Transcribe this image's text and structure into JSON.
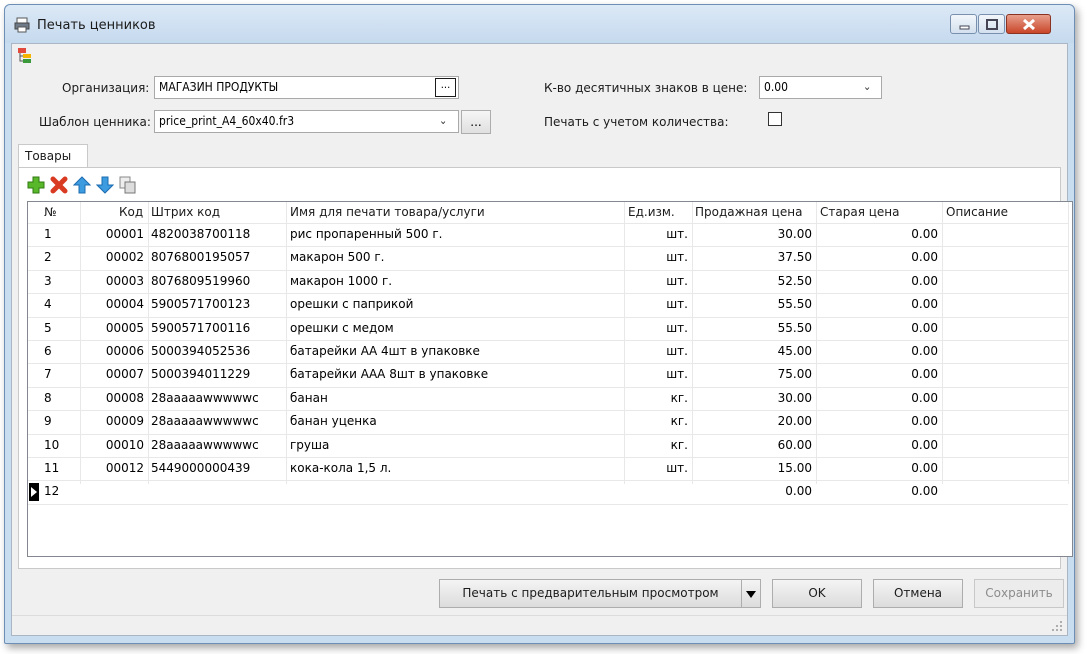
{
  "window": {
    "title": "Печать ценников"
  },
  "form": {
    "org_label": "Организация:",
    "org_value": "МАГАЗИН ПРОДУКТЫ",
    "org_button": "...",
    "template_label": "Шаблон ценника:",
    "template_value": "price_print_A4_60x40.fr3",
    "template_button": "...",
    "decimals_label": "К-во десятичных знаков в цене:",
    "decimals_value": "0.00",
    "print_qty_label": "Печать с учетом количества:",
    "print_qty_checked": false
  },
  "tabs": [
    {
      "label": "Товары"
    }
  ],
  "toolbar": {
    "icons": [
      "add-icon",
      "delete-icon",
      "move-up-icon",
      "move-down-icon",
      "copy-icon"
    ]
  },
  "grid": {
    "columns": [
      "№",
      "Код",
      "Штрих код",
      "Имя для печати товара/услуги",
      "Ед.изм.",
      "Продажная цена",
      "Старая цена",
      "Описание"
    ],
    "rows": [
      {
        "num": "1",
        "code": "00001",
        "barcode": "4820038700118",
        "name": "рис пропаренный 500 г.",
        "unit": "шт.",
        "price": "30.00",
        "old": "0.00",
        "desc": ""
      },
      {
        "num": "2",
        "code": "00002",
        "barcode": "8076800195057",
        "name": "макарон 500 г.",
        "unit": "шт.",
        "price": "37.50",
        "old": "0.00",
        "desc": ""
      },
      {
        "num": "3",
        "code": "00003",
        "barcode": "8076809519960",
        "name": "макарон 1000 г.",
        "unit": "шт.",
        "price": "52.50",
        "old": "0.00",
        "desc": ""
      },
      {
        "num": "4",
        "code": "00004",
        "barcode": "5900571700123",
        "name": "орешки с паприкой",
        "unit": "шт.",
        "price": "55.50",
        "old": "0.00",
        "desc": ""
      },
      {
        "num": "5",
        "code": "00005",
        "barcode": "5900571700116",
        "name": "орешки с медом",
        "unit": "шт.",
        "price": "55.50",
        "old": "0.00",
        "desc": ""
      },
      {
        "num": "6",
        "code": "00006",
        "barcode": "5000394052536",
        "name": "батарейки АА 4шт в упаковке",
        "unit": "шт.",
        "price": "45.00",
        "old": "0.00",
        "desc": ""
      },
      {
        "num": "7",
        "code": "00007",
        "barcode": "5000394011229",
        "name": "батарейки ААА 8шт в упаковке",
        "unit": "шт.",
        "price": "75.00",
        "old": "0.00",
        "desc": ""
      },
      {
        "num": "8",
        "code": "00008",
        "barcode": "28aaaaawwwwwc",
        "name": "банан",
        "unit": "кг.",
        "price": "30.00",
        "old": "0.00",
        "desc": ""
      },
      {
        "num": "9",
        "code": "00009",
        "barcode": "28aaaaawwwwwc",
        "name": "банан уценка",
        "unit": "кг.",
        "price": "20.00",
        "old": "0.00",
        "desc": ""
      },
      {
        "num": "10",
        "code": "00010",
        "barcode": "28aaaaawwwwwc",
        "name": "груша",
        "unit": "кг.",
        "price": "60.00",
        "old": "0.00",
        "desc": ""
      },
      {
        "num": "11",
        "code": "00012",
        "barcode": "5449000000439",
        "name": "кока-кола 1,5 л.",
        "unit": "шт.",
        "price": "15.00",
        "old": "0.00",
        "desc": ""
      },
      {
        "num": "12",
        "code": "",
        "barcode": "",
        "name": "",
        "unit": "",
        "price": "0.00",
        "old": "0.00",
        "desc": ""
      }
    ]
  },
  "buttons": {
    "print_preview": "Печать с предварительным просмотром",
    "ok": "OK",
    "cancel": "Отмена",
    "save": "Сохранить"
  }
}
